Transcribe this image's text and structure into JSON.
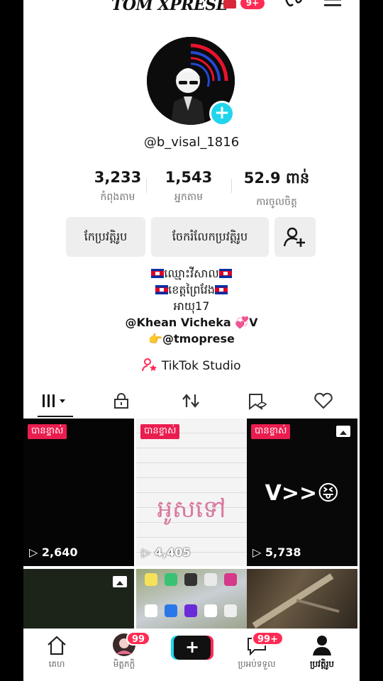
{
  "header": {
    "title": "TOM XPRESE",
    "notification_count": "9+"
  },
  "profile": {
    "username": "@b_visal_1816",
    "stats": [
      {
        "value": "3,233",
        "label": "កំពុងតាម"
      },
      {
        "value": "1,543",
        "label": "អ្នកតាម"
      },
      {
        "value": "52.9 ពាន់",
        "label": "ការចូលចិត្ត"
      }
    ],
    "buttons": {
      "edit": "កែប្រវត្តិរូប",
      "share": "ចែករំលែកប្រវត្តិរូប"
    },
    "bio": {
      "line1": "ឈ្មោះវីសាល",
      "line2": "ខេត្តព្រៃវែង",
      "line3": "អាយុ17",
      "line4": "@Khean Vicheka 💞V",
      "line5": "👉@tmoprese"
    },
    "studio_link": "TikTok Studio"
  },
  "tabs": [
    "videos",
    "private",
    "reposts",
    "favorites",
    "liked"
  ],
  "videos": [
    {
      "pinned": "បានខ្ទាស់",
      "views": "2,640"
    },
    {
      "pinned": "បានខ្ទាស់",
      "views": "4,405",
      "overlay_text": "អូសទៅ"
    },
    {
      "pinned": "បានខ្ទាស់",
      "views": "5,738",
      "overlay_text": "V>>😝"
    }
  ],
  "nav": {
    "home": "គេហ",
    "friends": "មិត្តភក្តិ",
    "friends_badge": "99",
    "inbox": "ប្រអប់ទទួល",
    "inbox_badge": "99+",
    "profile": "ប្រវត្តិរូប"
  },
  "colors": {
    "accent": "#fe2c55",
    "cyan": "#20d5ec",
    "pin": "#ea1d4f"
  }
}
